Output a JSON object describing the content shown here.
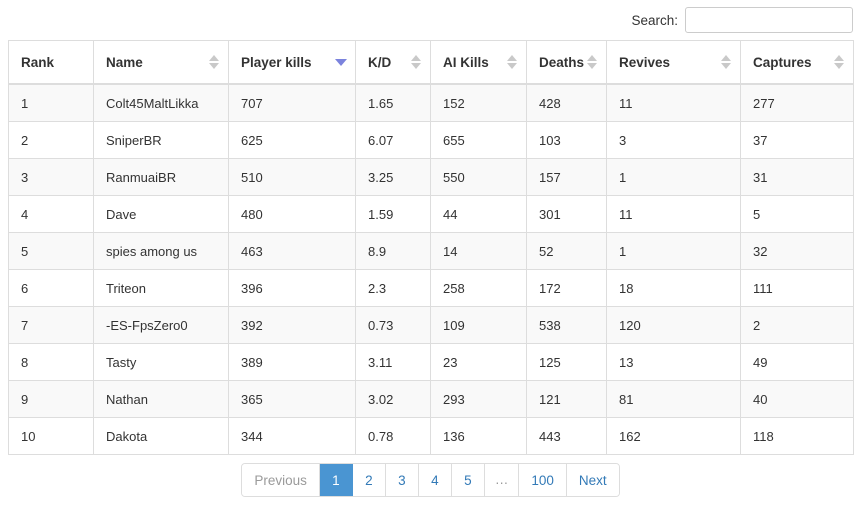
{
  "search": {
    "label": "Search:",
    "value": "",
    "placeholder": ""
  },
  "table": {
    "columns": [
      {
        "label": "Rank",
        "sort": "none"
      },
      {
        "label": "Name",
        "sort": "sortable"
      },
      {
        "label": "Player kills",
        "sort": "desc"
      },
      {
        "label": "K/D",
        "sort": "sortable"
      },
      {
        "label": "AI Kills",
        "sort": "sortable"
      },
      {
        "label": "Deaths",
        "sort": "sortable"
      },
      {
        "label": "Revives",
        "sort": "sortable"
      },
      {
        "label": "Captures",
        "sort": "sortable"
      }
    ],
    "rows": [
      {
        "rank": "1",
        "name": "Colt45MaltLikka",
        "player_kills": "707",
        "kd": "1.65",
        "ai_kills": "152",
        "deaths": "428",
        "revives": "11",
        "captures": "277"
      },
      {
        "rank": "2",
        "name": "SniperBR",
        "player_kills": "625",
        "kd": "6.07",
        "ai_kills": "655",
        "deaths": "103",
        "revives": "3",
        "captures": "37"
      },
      {
        "rank": "3",
        "name": "RanmuaiBR",
        "player_kills": "510",
        "kd": "3.25",
        "ai_kills": "550",
        "deaths": "157",
        "revives": "1",
        "captures": "31"
      },
      {
        "rank": "4",
        "name": "Dave",
        "player_kills": "480",
        "kd": "1.59",
        "ai_kills": "44",
        "deaths": "301",
        "revives": "11",
        "captures": "5"
      },
      {
        "rank": "5",
        "name": "spies among us",
        "player_kills": "463",
        "kd": "8.9",
        "ai_kills": "14",
        "deaths": "52",
        "revives": "1",
        "captures": "32"
      },
      {
        "rank": "6",
        "name": "Triteon",
        "player_kills": "396",
        "kd": "2.3",
        "ai_kills": "258",
        "deaths": "172",
        "revives": "18",
        "captures": "111"
      },
      {
        "rank": "7",
        "name": "-ES-FpsZero0",
        "player_kills": "392",
        "kd": "0.73",
        "ai_kills": "109",
        "deaths": "538",
        "revives": "120",
        "captures": "2"
      },
      {
        "rank": "8",
        "name": "Tasty",
        "player_kills": "389",
        "kd": "3.11",
        "ai_kills": "23",
        "deaths": "125",
        "revives": "13",
        "captures": "49"
      },
      {
        "rank": "9",
        "name": "Nathan",
        "player_kills": "365",
        "kd": "3.02",
        "ai_kills": "293",
        "deaths": "121",
        "revives": "81",
        "captures": "40"
      },
      {
        "rank": "10",
        "name": "Dakota",
        "player_kills": "344",
        "kd": "0.78",
        "ai_kills": "136",
        "deaths": "443",
        "revives": "162",
        "captures": "118"
      }
    ]
  },
  "pagination": {
    "previous_label": "Previous",
    "next_label": "Next",
    "ellipsis": "…",
    "active_page": "1",
    "pages": [
      "1",
      "2",
      "3",
      "4",
      "5",
      "…",
      "100"
    ],
    "active_color": "#4a95d2",
    "link_color": "#337ab7"
  }
}
